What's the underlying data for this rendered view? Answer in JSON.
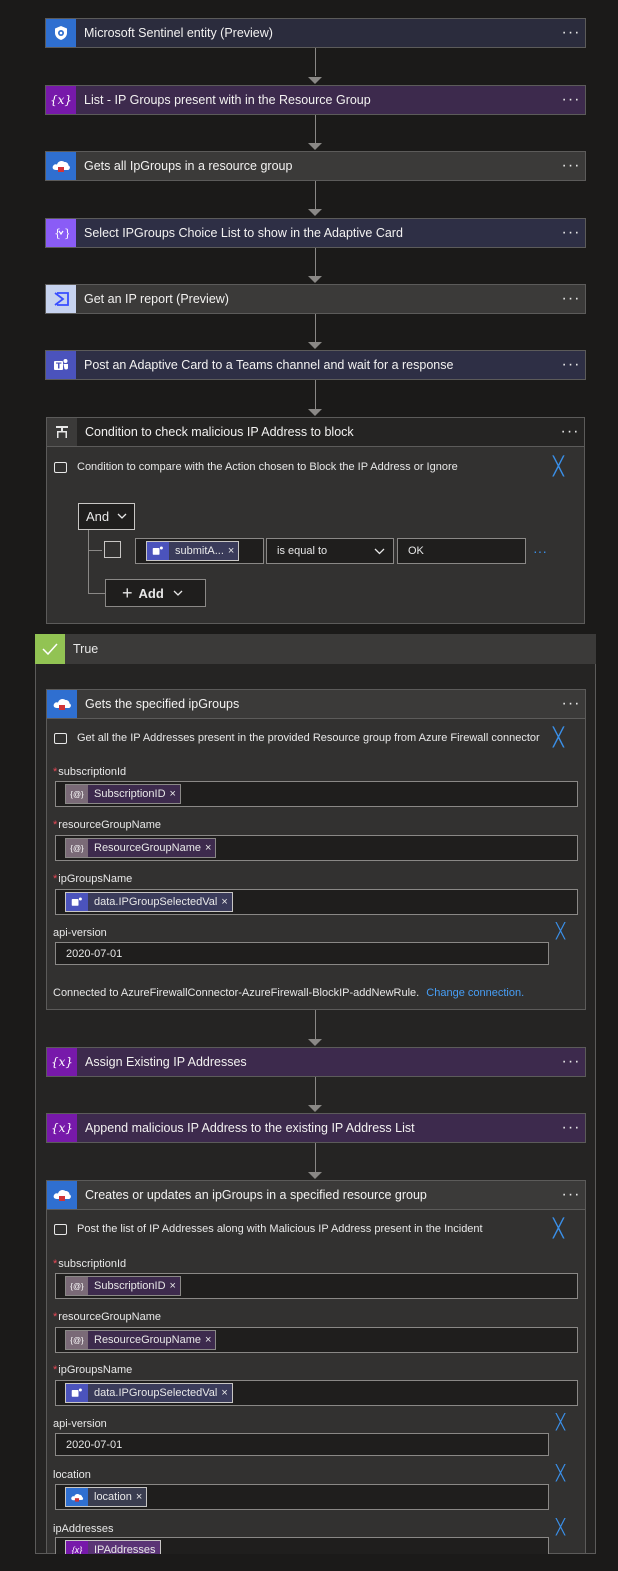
{
  "steps": {
    "s1": {
      "label": "Microsoft Sentinel entity (Preview)",
      "icon": "sentinel-shield-icon"
    },
    "s2": {
      "label": "List - IP Groups present with in the Resource Group",
      "icon": "variable-icon"
    },
    "s3": {
      "label": "Gets all IpGroups in a resource group",
      "icon": "azure-cloud-icon"
    },
    "s4": {
      "label": "Select IPGroups Choice List to show in the Adaptive Card",
      "icon": "select-icon"
    },
    "s5": {
      "label": "Get an IP report (Preview)",
      "icon": "virustotal-icon"
    },
    "s6": {
      "label": "Post an Adaptive Card to a Teams channel and wait for a response",
      "icon": "teams-icon"
    }
  },
  "more_glyph": "···",
  "close_glyph": "╳",
  "condition": {
    "title": "Condition to check malicious IP Address to block",
    "description": "Condition to compare with the Action chosen to Block the IP Address or Ignore",
    "logic": "And",
    "token": "submitA...",
    "operator": "is equal to",
    "value": "OK",
    "add_label": "Add"
  },
  "true_branch": {
    "label": "True",
    "get_ipgroups": {
      "title": "Gets the specified ipGroups",
      "description": "Get all the IP Addresses present in the provided Resource group from Azure Firewall connector",
      "fields": {
        "subscription": {
          "label": "subscriptionId",
          "token": "SubscriptionID"
        },
        "rg": {
          "label": "resourceGroupName",
          "token": "ResourceGroupName"
        },
        "ipg": {
          "label": "ipGroupsName",
          "token": "data.IPGroupSelectedVal"
        },
        "api": {
          "label": "api-version",
          "value": "2020-07-01"
        }
      },
      "connected_text": "Connected to AzureFirewallConnector-AzureFirewall-BlockIP-addNewRule.",
      "change_link": "Change connection."
    },
    "assign": {
      "label": "Assign Existing IP Addresses"
    },
    "append": {
      "label": "Append malicious IP Address to the existing IP Address List"
    },
    "create": {
      "title": "Creates or updates an ipGroups in a specified resource group",
      "description": "Post the list of IP Addresses along with Malicious IP Address present in the Incident",
      "fields": {
        "subscription": {
          "label": "subscriptionId",
          "token": "SubscriptionID"
        },
        "rg": {
          "label": "resourceGroupName",
          "token": "ResourceGroupName"
        },
        "ipg": {
          "label": "ipGroupsName",
          "token": "data.IPGroupSelectedVal"
        },
        "api": {
          "label": "api-version",
          "value": "2020-07-01"
        },
        "location": {
          "label": "location",
          "token": "location"
        },
        "ipaddr": {
          "label": "ipAddresses",
          "token": "IPAddresses"
        }
      }
    }
  },
  "colors": {
    "accent": "#3a8fe8",
    "true_green": "#92c353",
    "required": "#e74856"
  }
}
